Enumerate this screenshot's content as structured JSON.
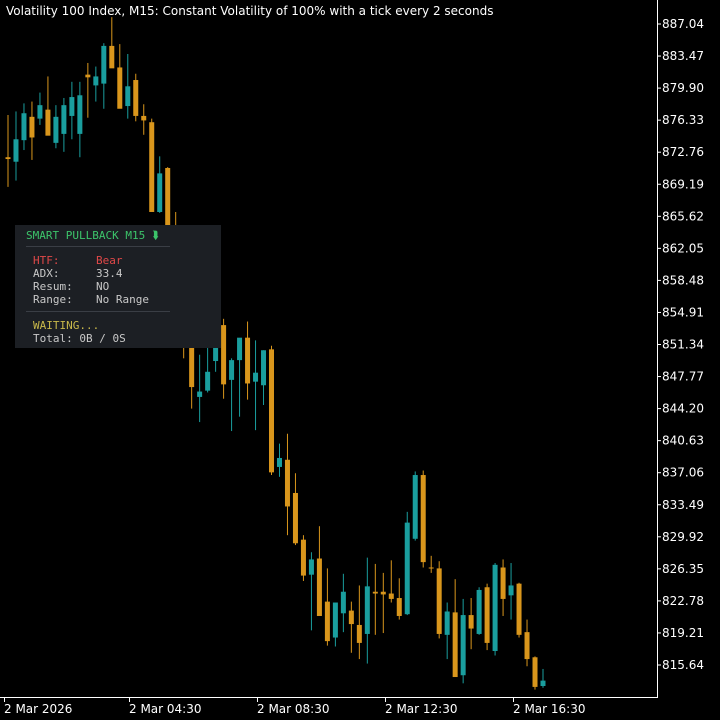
{
  "chart_title": "Volatility 100 Index, M15:  Constant Volatility of 100% with a tick every 2 seconds",
  "colors": {
    "background": "#000000",
    "bull": "#1a9e9e",
    "bear": "#d9961c",
    "axis_text": "#ffffff",
    "panel_bg": "#1c1f24",
    "panel_header": "#3cc46a",
    "htf_red": "#e04848",
    "panel_text": "#c8c8c8",
    "waiting": "#c8b84a"
  },
  "panel": {
    "header": "SMART PULLBACK M15",
    "arrow": "⮯",
    "htf_label": "HTF:",
    "htf_value": "Bear",
    "adx_label": "ADX:",
    "adx_value": "33.4",
    "resum_label": "Resum:",
    "resum_value": "NO",
    "range_label": "Range:",
    "range_value": "No Range",
    "status": "WAITING...",
    "total": "Total: 0B / 0S"
  },
  "chart_data": {
    "type": "candlestick",
    "symbol": "Volatility 100 Index",
    "timeframe": "M15",
    "y_ticks": [
      "887.04",
      "883.47",
      "879.90",
      "876.33",
      "872.76",
      "869.19",
      "865.62",
      "862.05",
      "858.48",
      "854.91",
      "851.34",
      "847.77",
      "844.20",
      "840.63",
      "837.06",
      "833.49",
      "829.92",
      "826.35",
      "822.78",
      "819.21",
      "815.64"
    ],
    "x_ticks": [
      "2 Mar 2026",
      "2 Mar 04:30",
      "2 Mar 08:30",
      "2 Mar 12:30",
      "2 Mar 16:30"
    ],
    "ylim": [
      812.2,
      888.9
    ],
    "candles": [
      {
        "o": 872.2,
        "h": 876.9,
        "l": 868.9,
        "c": 872.0
      },
      {
        "o": 871.7,
        "h": 877.3,
        "l": 869.6,
        "c": 874.2
      },
      {
        "o": 874.1,
        "h": 878.2,
        "l": 873.0,
        "c": 877.1
      },
      {
        "o": 876.7,
        "h": 878.4,
        "l": 871.9,
        "c": 874.4
      },
      {
        "o": 876.5,
        "h": 879.4,
        "l": 875.8,
        "c": 878.0
      },
      {
        "o": 877.5,
        "h": 881.2,
        "l": 875.0,
        "c": 874.6
      },
      {
        "o": 873.8,
        "h": 878.0,
        "l": 873.2,
        "c": 876.7
      },
      {
        "o": 874.8,
        "h": 878.8,
        "l": 872.8,
        "c": 878.0
      },
      {
        "o": 876.8,
        "h": 880.6,
        "l": 874.2,
        "c": 878.9
      },
      {
        "o": 874.8,
        "h": 880.6,
        "l": 872.2,
        "c": 879.1
      },
      {
        "o": 881.4,
        "h": 882.7,
        "l": 876.6,
        "c": 881.1
      },
      {
        "o": 880.2,
        "h": 882.3,
        "l": 878.4,
        "c": 881.2
      },
      {
        "o": 880.4,
        "h": 884.9,
        "l": 877.6,
        "c": 884.6
      },
      {
        "o": 884.6,
        "h": 887.8,
        "l": 883.7,
        "c": 882.1
      },
      {
        "o": 882.2,
        "h": 884.8,
        "l": 878.5,
        "c": 877.6
      },
      {
        "o": 877.9,
        "h": 883.7,
        "l": 876.5,
        "c": 880.1
      },
      {
        "o": 880.8,
        "h": 881.5,
        "l": 876.2,
        "c": 876.8
      },
      {
        "o": 876.8,
        "h": 878.1,
        "l": 874.7,
        "c": 876.3
      },
      {
        "o": 876.1,
        "h": 876.5,
        "l": 867.1,
        "c": 866.1
      },
      {
        "o": 866.1,
        "h": 872.3,
        "l": 866.0,
        "c": 870.4
      },
      {
        "o": 871.0,
        "h": 871.1,
        "l": 863.1,
        "c": 864.5
      },
      {
        "o": 863.5,
        "h": 866.1,
        "l": 858.5,
        "c": 859.6
      },
      {
        "o": 859.3,
        "h": 860.4,
        "l": 849.8,
        "c": 851.0
      },
      {
        "o": 851.3,
        "h": 852.0,
        "l": 844.2,
        "c": 846.6
      },
      {
        "o": 845.5,
        "h": 850.2,
        "l": 842.7,
        "c": 846.1
      },
      {
        "o": 846.2,
        "h": 852.5,
        "l": 846.0,
        "c": 848.3
      },
      {
        "o": 849.5,
        "h": 855.2,
        "l": 848.3,
        "c": 854.3
      },
      {
        "o": 853.5,
        "h": 854.2,
        "l": 845.3,
        "c": 846.9
      },
      {
        "o": 847.4,
        "h": 849.8,
        "l": 841.7,
        "c": 849.6
      },
      {
        "o": 849.6,
        "h": 851.7,
        "l": 843.3,
        "c": 852.1
      },
      {
        "o": 852.1,
        "h": 853.9,
        "l": 845.2,
        "c": 847.0
      },
      {
        "o": 847.2,
        "h": 851.8,
        "l": 841.8,
        "c": 848.2
      },
      {
        "o": 846.8,
        "h": 850.7,
        "l": 844.6,
        "c": 850.7
      },
      {
        "o": 850.8,
        "h": 851.2,
        "l": 836.8,
        "c": 837.1
      },
      {
        "o": 837.7,
        "h": 840.3,
        "l": 836.6,
        "c": 838.7
      },
      {
        "o": 838.5,
        "h": 841.4,
        "l": 830.1,
        "c": 833.3
      },
      {
        "o": 834.8,
        "h": 837.0,
        "l": 829.0,
        "c": 829.2
      },
      {
        "o": 829.6,
        "h": 830.1,
        "l": 825.0,
        "c": 825.6
      },
      {
        "o": 825.7,
        "h": 828.2,
        "l": 819.5,
        "c": 827.4
      },
      {
        "o": 827.5,
        "h": 831.1,
        "l": 821.8,
        "c": 821.1
      },
      {
        "o": 822.7,
        "h": 826.4,
        "l": 817.8,
        "c": 818.3
      },
      {
        "o": 818.7,
        "h": 821.3,
        "l": 817.7,
        "c": 822.6
      },
      {
        "o": 821.4,
        "h": 825.8,
        "l": 819.3,
        "c": 823.8
      },
      {
        "o": 821.7,
        "h": 822.7,
        "l": 817.0,
        "c": 820.2
      },
      {
        "o": 820.1,
        "h": 824.5,
        "l": 816.3,
        "c": 818.1
      },
      {
        "o": 819.1,
        "h": 827.6,
        "l": 815.8,
        "c": 824.4
      },
      {
        "o": 823.8,
        "h": 826.9,
        "l": 819.0,
        "c": 823.6
      },
      {
        "o": 823.8,
        "h": 825.9,
        "l": 819.2,
        "c": 823.5
      },
      {
        "o": 823.6,
        "h": 827.3,
        "l": 822.6,
        "c": 823.0
      },
      {
        "o": 823.1,
        "h": 825.3,
        "l": 820.7,
        "c": 821.1
      },
      {
        "o": 821.3,
        "h": 832.7,
        "l": 821.2,
        "c": 831.5
      },
      {
        "o": 829.7,
        "h": 837.2,
        "l": 829.5,
        "c": 836.8
      },
      {
        "o": 836.8,
        "h": 837.3,
        "l": 826.5,
        "c": 827.1
      },
      {
        "o": 826.5,
        "h": 827.8,
        "l": 825.9,
        "c": 826.4
      },
      {
        "o": 826.4,
        "h": 827.2,
        "l": 818.6,
        "c": 819.1
      },
      {
        "o": 819.0,
        "h": 822.6,
        "l": 816.3,
        "c": 821.6
      },
      {
        "o": 821.5,
        "h": 825.2,
        "l": 814.4,
        "c": 814.3
      },
      {
        "o": 814.5,
        "h": 823.0,
        "l": 813.6,
        "c": 821.2
      },
      {
        "o": 821.2,
        "h": 823.1,
        "l": 817.4,
        "c": 819.7
      },
      {
        "o": 819.1,
        "h": 824.3,
        "l": 819.0,
        "c": 824.0
      },
      {
        "o": 824.3,
        "h": 824.7,
        "l": 817.3,
        "c": 818.1
      },
      {
        "o": 817.2,
        "h": 827.0,
        "l": 816.7,
        "c": 826.8
      },
      {
        "o": 826.5,
        "h": 827.4,
        "l": 821.1,
        "c": 823.0
      },
      {
        "o": 823.4,
        "h": 827.0,
        "l": 820.7,
        "c": 824.5
      },
      {
        "o": 824.7,
        "h": 824.8,
        "l": 818.7,
        "c": 819.0
      },
      {
        "o": 819.3,
        "h": 820.7,
        "l": 815.5,
        "c": 816.3
      },
      {
        "o": 816.5,
        "h": 816.6,
        "l": 812.9,
        "c": 813.2
      },
      {
        "o": 813.3,
        "h": 815.2,
        "l": 813.1,
        "c": 813.9
      }
    ]
  }
}
